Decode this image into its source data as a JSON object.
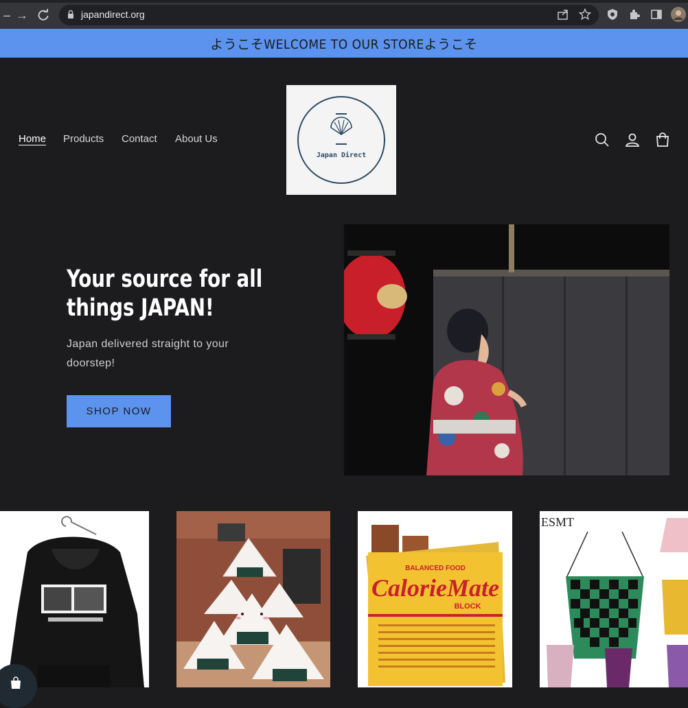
{
  "browser": {
    "url": "japandirect.org"
  },
  "announcement": {
    "text": "ようこそWELCOME TO OUR STOREようこそ"
  },
  "header": {
    "nav": [
      "Home",
      "Products",
      "Contact",
      "About Us"
    ],
    "logo_text": "Japan Direct",
    "icons": [
      "search-icon",
      "account-icon",
      "cart-icon"
    ]
  },
  "hero": {
    "title": "Your source for all things JAPAN!",
    "subtitle": "Japan delivered straight to your doorstep!",
    "button": "SHOP NOW"
  },
  "products": {
    "calorie_top": "BALANCED FOOD",
    "calorie_brand": "CalorieMate",
    "calorie_bottom": "BLOCK",
    "bag_brand": "ESMT"
  },
  "colors": {
    "accent": "#5b93ee",
    "background": "#1c1c1e",
    "logo_ink": "#2d4a64"
  }
}
